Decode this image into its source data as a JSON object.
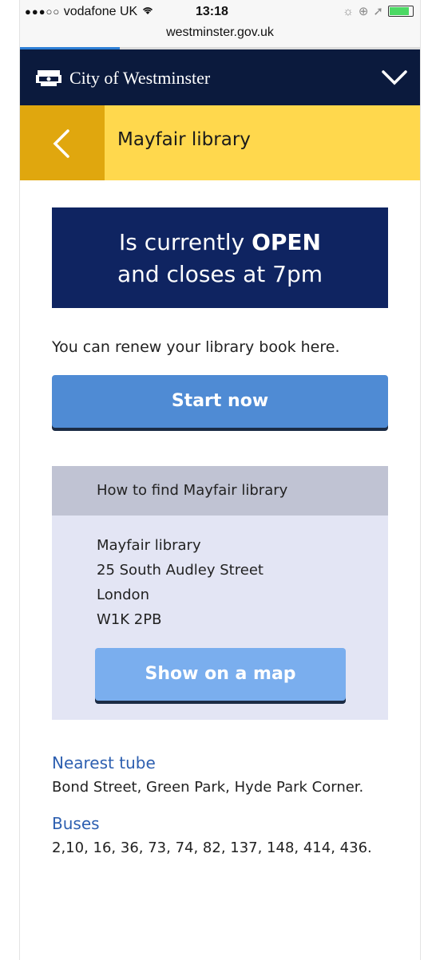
{
  "status_bar": {
    "carrier": "vodafone UK",
    "time": "13:18",
    "url": "westminster.gov.uk",
    "page_load_progress": 0.25
  },
  "header": {
    "site_name": "City of Westminster",
    "menu_icon": "chevron-down-icon"
  },
  "titlebar": {
    "back_icon": "chevron-left-icon",
    "title": "Mayfair library"
  },
  "banner": {
    "line1_prefix": "Is currently ",
    "line1_status": "OPEN",
    "line2": "and closes at 7pm"
  },
  "renew_text": "You can renew your library book here.",
  "start_button": "Start now",
  "find": {
    "heading": "How to find Mayfair library",
    "address": [
      "Mayfair library",
      "25 South Audley Street",
      "London",
      "W1K 2PB"
    ],
    "map_button": "Show on a map"
  },
  "transport": {
    "tube_heading": "Nearest tube",
    "tube_text": "Bond Street, Green Park, Hyde Park Corner.",
    "bus_heading": "Buses",
    "bus_text": "2,10, 16, 36, 73, 74, 82, 137, 148, 414, 436."
  },
  "colors": {
    "header_bg": "#0b1a3d",
    "titlebar_bg": "#ffd84d",
    "back_bg": "#e0a70e",
    "banner_bg": "#0f2461",
    "primary_button": "#4f8bd4",
    "map_button": "#7aaeee",
    "link": "#2d5fb0"
  }
}
